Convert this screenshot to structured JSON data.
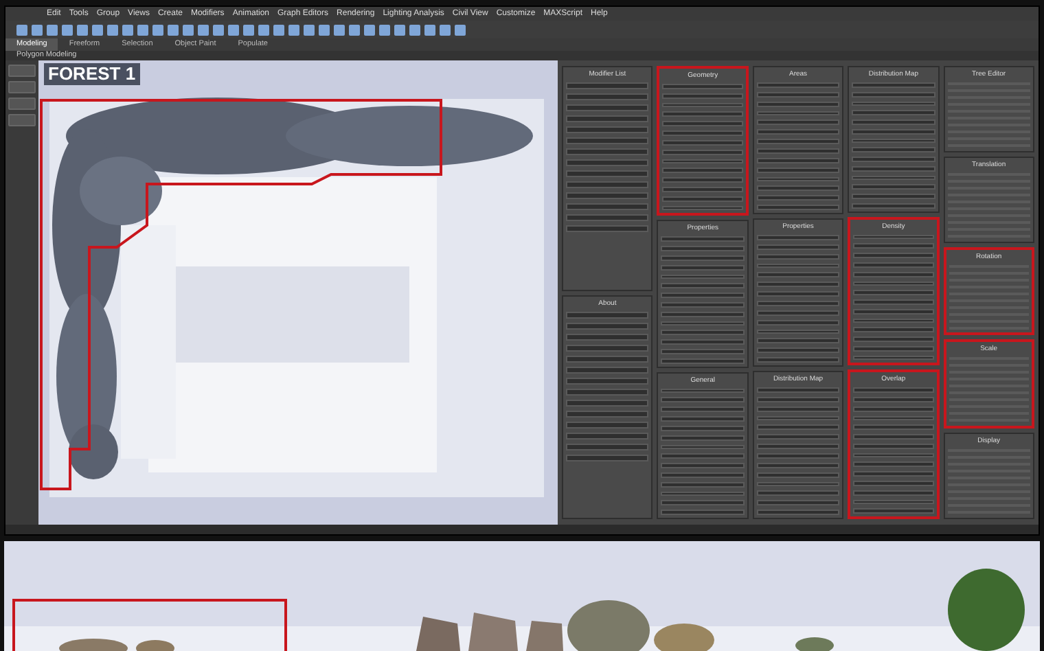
{
  "menu": [
    "Edit",
    "Tools",
    "Group",
    "Views",
    "Create",
    "Modifiers",
    "Animation",
    "Graph Editors",
    "Rendering",
    "Lighting Analysis",
    "Civil View",
    "Customize",
    "MAXScript",
    "Help"
  ],
  "ribbon_tabs": [
    {
      "label": "Modeling",
      "selected": true
    },
    {
      "label": "Freeform",
      "selected": false
    },
    {
      "label": "Selection",
      "selected": false
    },
    {
      "label": "Object Paint",
      "selected": false
    },
    {
      "label": "Populate",
      "selected": false
    }
  ],
  "ribbon_title": "Polygon Modeling",
  "viewport": {
    "label": "FOREST 1"
  },
  "panel_columns": [
    {
      "sections": [
        {
          "title": "Modifier List",
          "highlighted": false
        },
        {
          "title": "About",
          "highlighted": false
        }
      ]
    },
    {
      "sections": [
        {
          "title": "Geometry",
          "highlighted": true
        },
        {
          "title": "Properties",
          "highlighted": false
        },
        {
          "title": "General",
          "highlighted": false
        }
      ]
    },
    {
      "sections": [
        {
          "title": "Areas",
          "highlighted": false
        },
        {
          "title": "Properties",
          "highlighted": false
        },
        {
          "title": "Distribution Map",
          "highlighted": false
        }
      ]
    },
    {
      "sections": [
        {
          "title": "Distribution Map",
          "highlighted": false
        },
        {
          "title": "Density",
          "highlighted": true
        },
        {
          "title": "Overlap",
          "highlighted": true
        }
      ]
    },
    {
      "sections": [
        {
          "title": "Tree Editor",
          "highlighted": false
        },
        {
          "title": "Translation",
          "highlighted": false
        },
        {
          "title": "Rotation",
          "highlighted": true
        },
        {
          "title": "Scale",
          "highlighted": true
        },
        {
          "title": "Display",
          "highlighted": false
        }
      ]
    }
  ]
}
